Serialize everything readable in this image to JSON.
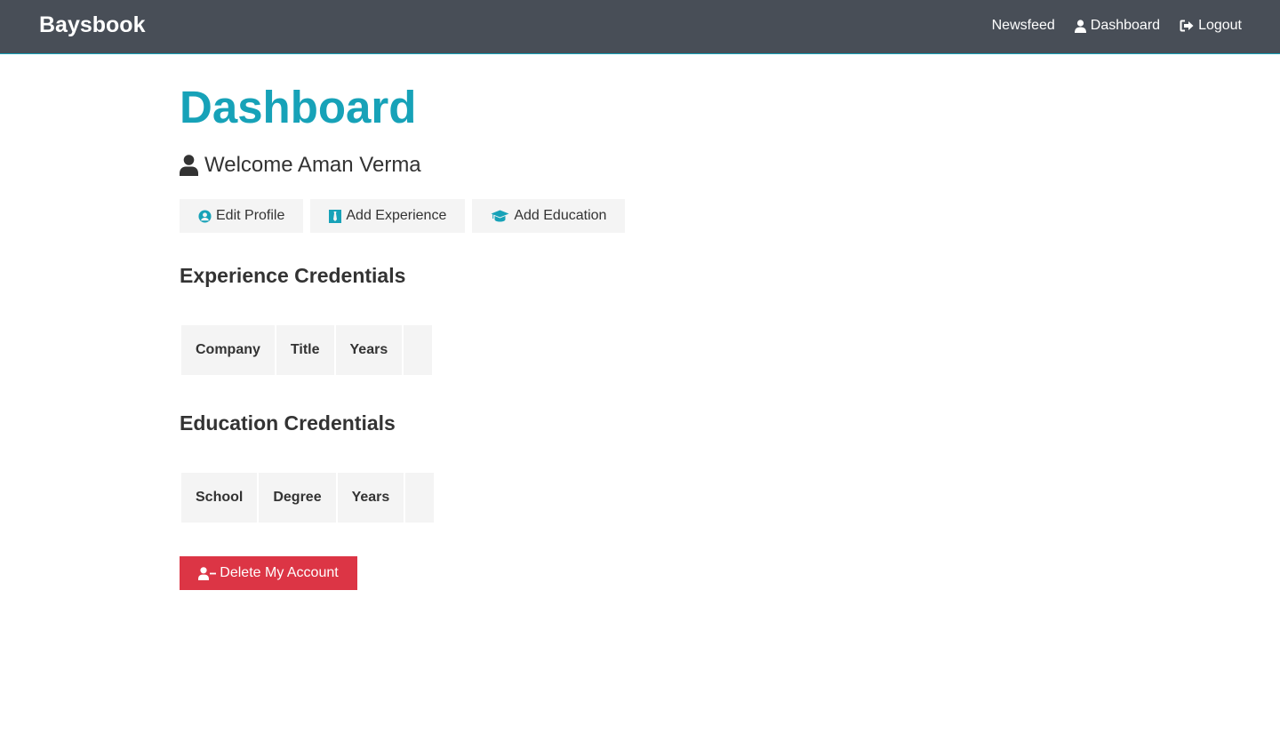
{
  "nav": {
    "brand": "Baysbook",
    "links": [
      {
        "label": "Newsfeed",
        "icon": ""
      },
      {
        "label": "Dashboard",
        "icon": "user-icon"
      },
      {
        "label": "Logout",
        "icon": "sign-out-icon"
      }
    ]
  },
  "page": {
    "title": "Dashboard",
    "welcome": "Welcome Aman Verma"
  },
  "actions": {
    "edit_profile": "Edit Profile",
    "add_experience": "Add Experience",
    "add_education": "Add Education",
    "delete_account": "Delete My Account"
  },
  "experience": {
    "heading": "Experience Credentials",
    "columns": [
      "Company",
      "Title",
      "Years",
      ""
    ]
  },
  "education": {
    "heading": "Education Credentials",
    "columns": [
      "School",
      "Degree",
      "Years",
      ""
    ]
  },
  "colors": {
    "navbar": "#484e57",
    "accent": "#17a2b8",
    "danger": "#dc3545",
    "light_button": "#f4f4f4",
    "text": "#333333"
  }
}
